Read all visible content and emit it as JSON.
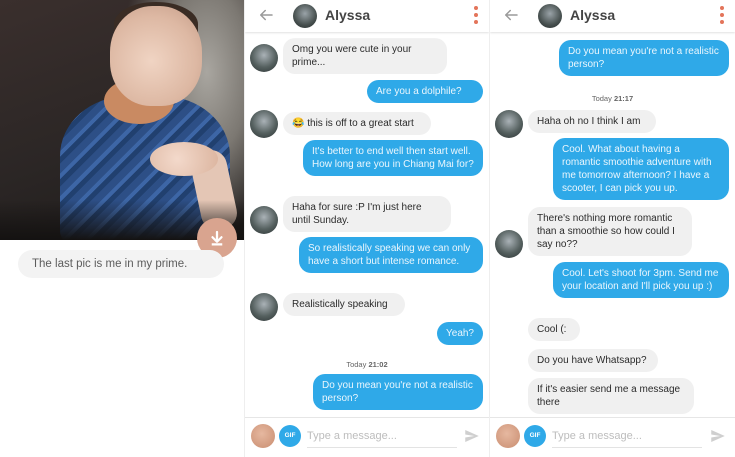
{
  "photo_panel": {
    "caption": "The last pic is me in my prime.",
    "badge_icon": "down-arrow-icon"
  },
  "chat_one": {
    "header": {
      "name": "Alyssa",
      "back_icon": "back-arrow-icon",
      "menu_icon": "kebab-menu-icon"
    },
    "messages": [
      {
        "dir": "in",
        "text": "Omg you were cute in your prime..."
      },
      {
        "dir": "out",
        "text": "Are you a dolphile?"
      },
      {
        "dir": "in",
        "text": "😂 this is off to a great start"
      },
      {
        "dir": "out",
        "text": "It's better to end well then start well. How long are you in Chiang Mai for?"
      },
      {
        "dir": "in",
        "text": "Haha for sure :P I'm just here until Sunday."
      },
      {
        "dir": "out",
        "text": "So realistically speaking we can only have a short but intense romance."
      },
      {
        "dir": "in",
        "text": "Realistically speaking"
      },
      {
        "dir": "out",
        "text": "Yeah?"
      },
      {
        "dir": "stamp",
        "day": "Today",
        "time": "21:02"
      },
      {
        "dir": "out",
        "text": "Do you mean you're not a realistic person?"
      }
    ],
    "composer": {
      "placeholder": "Type a message...",
      "gif_label": "GIF"
    }
  },
  "chat_two": {
    "header": {
      "name": "Alyssa",
      "back_icon": "back-arrow-icon",
      "menu_icon": "kebab-menu-icon"
    },
    "messages": [
      {
        "dir": "out",
        "text": "Do you mean you're not a realistic person?"
      },
      {
        "dir": "stamp",
        "day": "Today",
        "time": "21:17"
      },
      {
        "dir": "in",
        "text": "Haha oh no I think I am"
      },
      {
        "dir": "out",
        "text": "Cool. What about having a romantic smoothie adventure with me tomorrow afternoon? I have a scooter, I can pick you up."
      },
      {
        "dir": "in",
        "text": "There's nothing more romantic than a smoothie so how could I say no??"
      },
      {
        "dir": "out",
        "text": "Cool. Let's shoot for 3pm. Send me your location and I'll pick you up :)"
      },
      {
        "dir": "in",
        "text": "Cool (:"
      },
      {
        "dir": "in",
        "text": "Do you have Whatsapp?"
      },
      {
        "dir": "in",
        "text": "If it's easier send me a message there"
      }
    ],
    "composer": {
      "placeholder": "Type a message...",
      "gif_label": "GIF"
    }
  },
  "colors": {
    "outgoing_bubble": "#2fa9e8",
    "incoming_bubble": "#f0f0f0",
    "accent": "#e3745a"
  }
}
